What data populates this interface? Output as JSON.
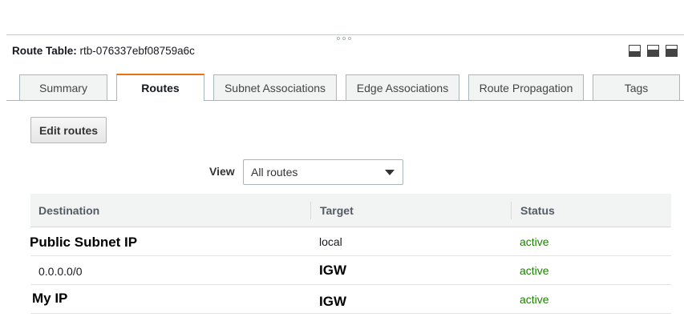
{
  "panel": {
    "title_label": "Route Table:",
    "title_value": "rtb-076337ebf08759a6c"
  },
  "layout_icons": [
    "panel-bottom-icon",
    "panel-split-icon",
    "panel-full-icon"
  ],
  "tabs": [
    {
      "label": "Summary"
    },
    {
      "label": "Routes",
      "active": true
    },
    {
      "label": "Subnet Associations"
    },
    {
      "label": "Edge Associations"
    },
    {
      "label": "Route Propagation"
    },
    {
      "label": "Tags"
    }
  ],
  "edit_button": "Edit routes",
  "view": {
    "label": "View",
    "selected": "All routes"
  },
  "table": {
    "headers": [
      "Destination",
      "Target",
      "Status"
    ],
    "rows": [
      {
        "destination": "Public Subnet IP",
        "target": "local",
        "status": "active"
      },
      {
        "destination": "0.0.0.0/0",
        "target": "IGW",
        "status": "active"
      },
      {
        "destination": "My IP",
        "target": "IGW",
        "status": "active"
      }
    ]
  },
  "colors": {
    "active_tab_accent": "#ec7211",
    "status_active": "#1d8102",
    "header_bg": "#f2f3f3"
  }
}
